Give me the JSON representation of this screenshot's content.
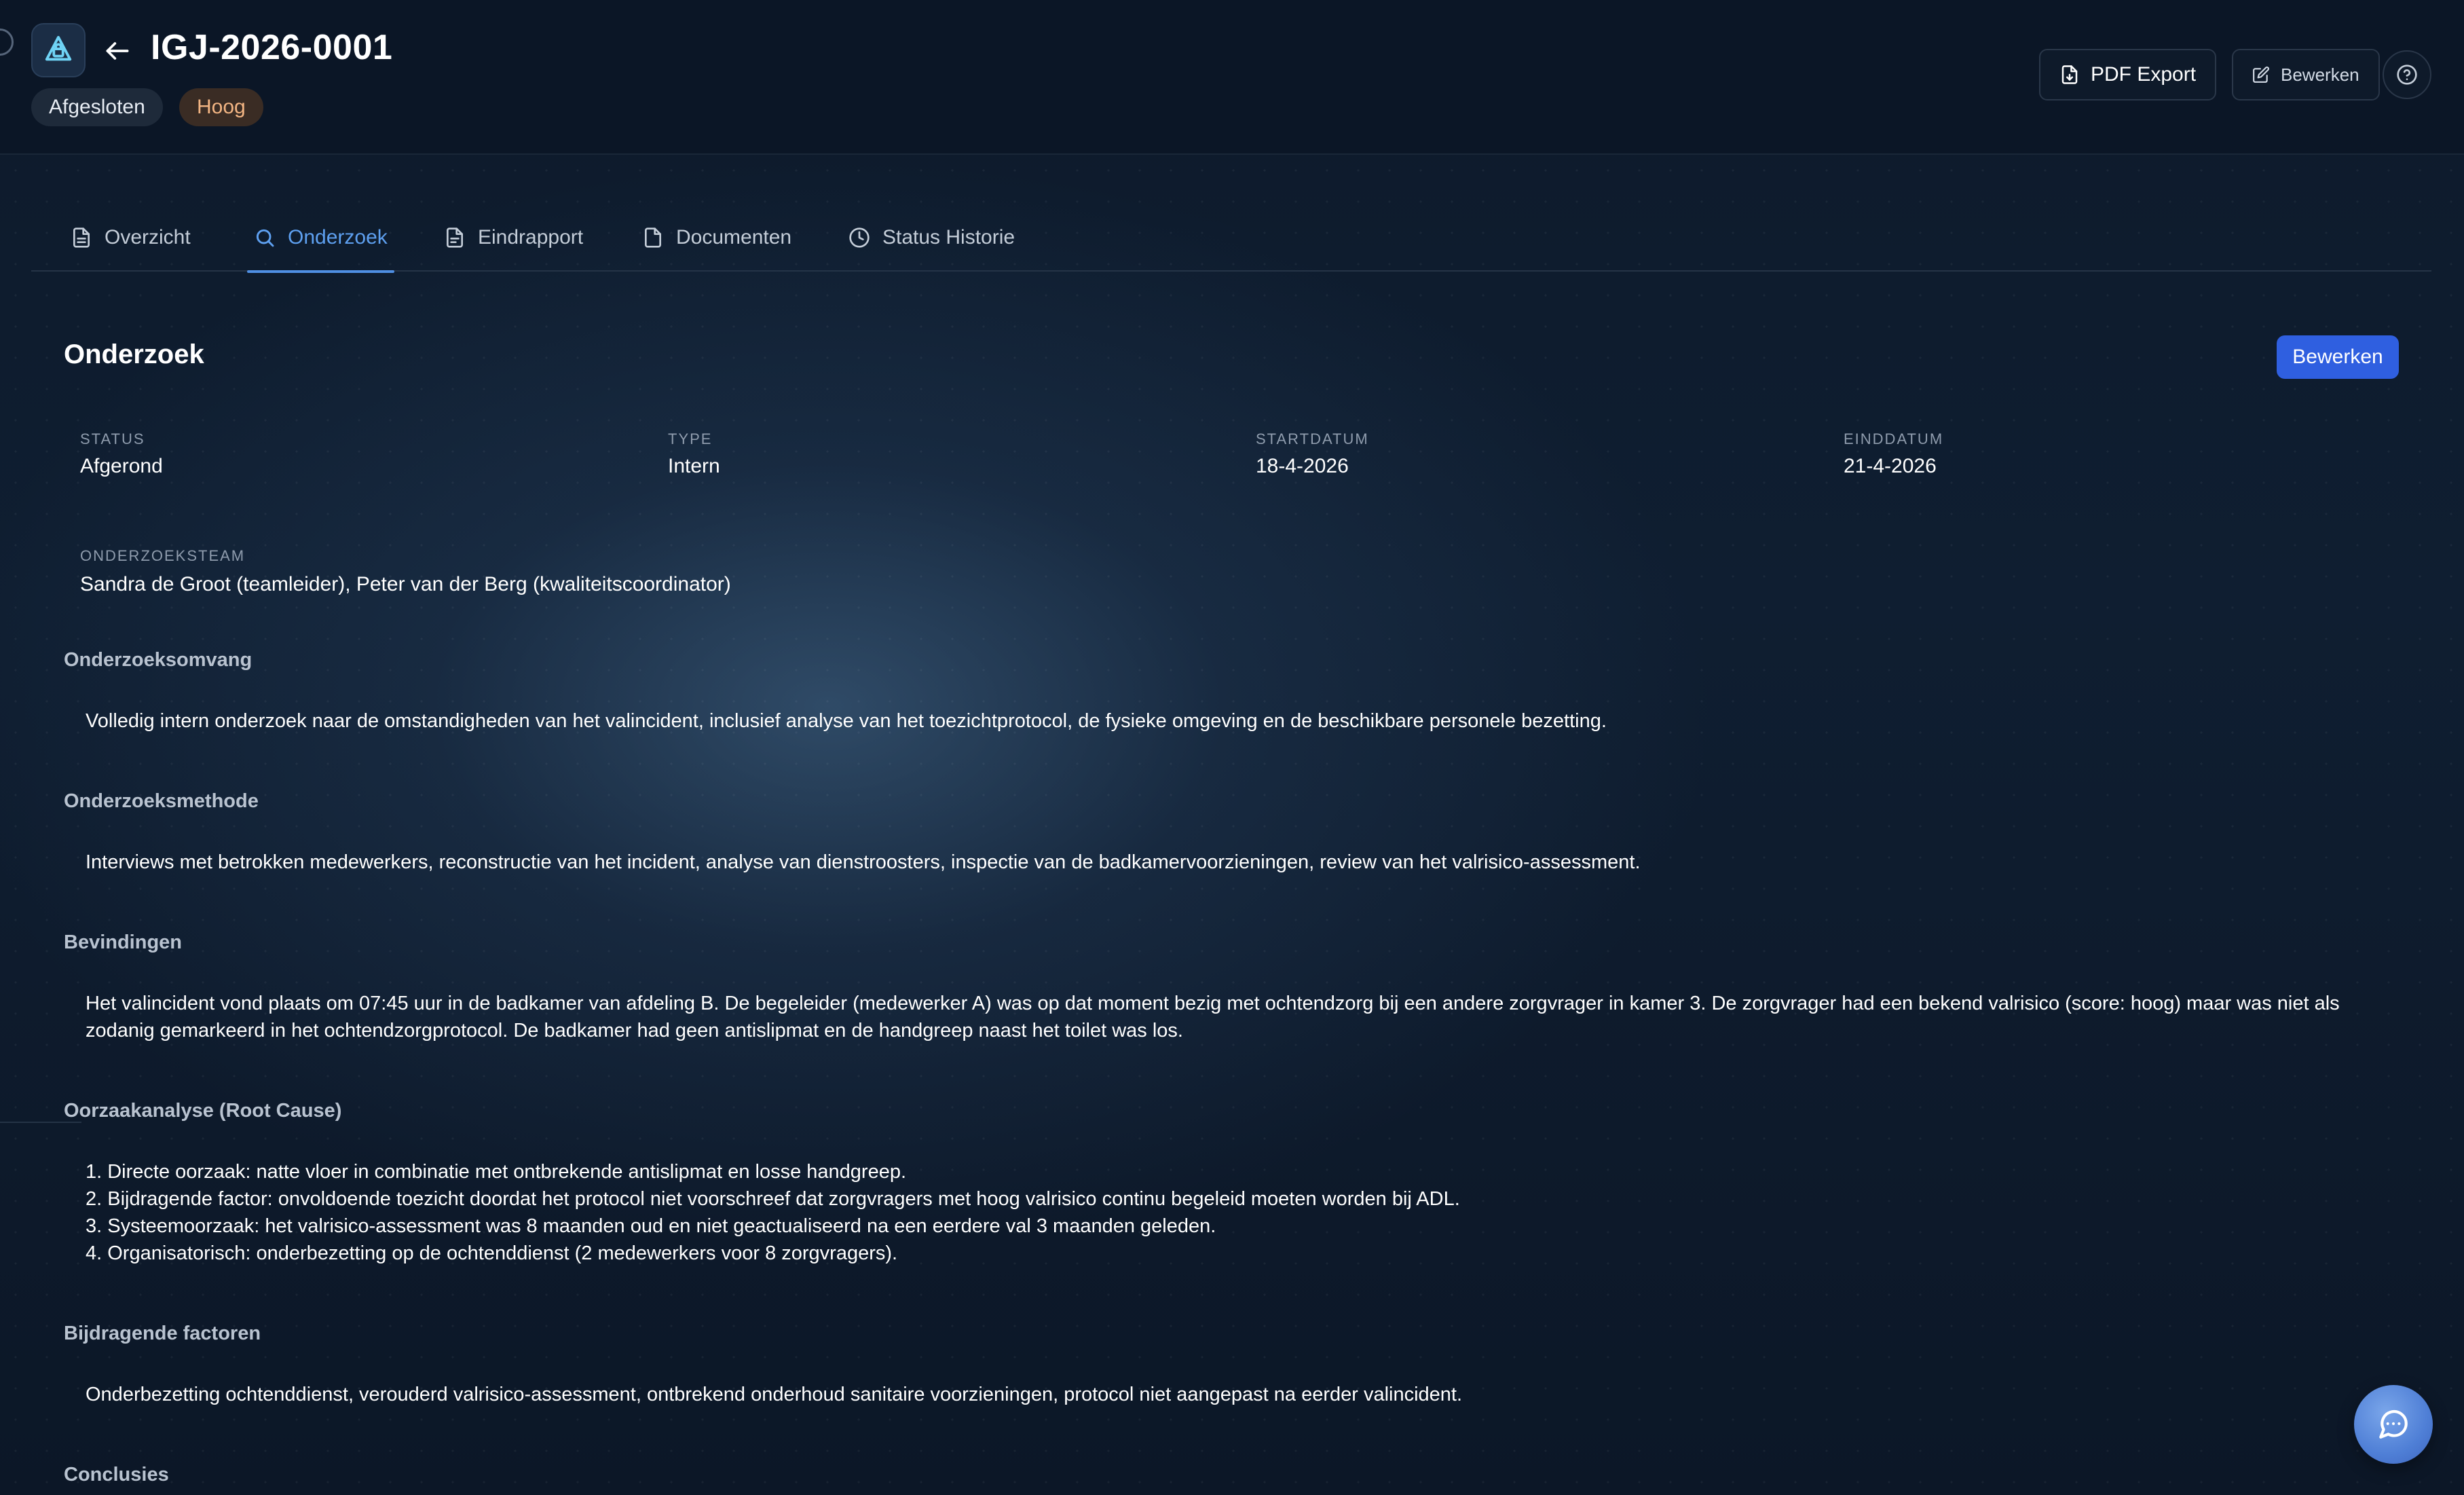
{
  "header": {
    "case_id": "IGJ-2026-0001",
    "status_badge": "Afgesloten",
    "priority_badge": "Hoog",
    "pdf_export_label": "PDF Export",
    "edit_label": "Bewerken"
  },
  "tabs": [
    {
      "label": "Overzicht",
      "icon": "document-icon"
    },
    {
      "label": "Onderzoek",
      "icon": "search-icon",
      "active": true
    },
    {
      "label": "Eindrapport",
      "icon": "report-icon"
    },
    {
      "label": "Documenten",
      "icon": "file-icon"
    },
    {
      "label": "Status Historie",
      "icon": "clock-icon"
    }
  ],
  "investigation": {
    "title": "Onderzoek",
    "edit_button": "Bewerken",
    "fields": [
      {
        "label": "Status",
        "value": "Afgerond"
      },
      {
        "label": "Type",
        "value": "Intern"
      },
      {
        "label": "Startdatum",
        "value": "18-4-2026"
      },
      {
        "label": "Einddatum",
        "value": "21-4-2026"
      }
    ],
    "team_label": "Onderzoeksteam",
    "team_value": "Sandra de Groot (teamleider), Peter van der Berg (kwaliteitscoordinator)",
    "sections": [
      {
        "title": "Onderzoeksomvang",
        "text": "Volledig intern onderzoek naar de omstandigheden van het valincident, inclusief analyse van het toezichtprotocol, de fysieke omgeving en de beschikbare personele bezetting."
      },
      {
        "title": "Onderzoeksmethode",
        "text": "Interviews met betrokken medewerkers, reconstructie van het incident, analyse van dienstroosters, inspectie van de badkamervoorzieningen, review van het valrisico-assessment."
      },
      {
        "title": "Bevindingen",
        "text": "Het valincident vond plaats om 07:45 uur in de badkamer van afdeling B. De begeleider (medewerker A) was op dat moment bezig met ochtendzorg bij een andere zorgvrager in kamer 3. De zorgvrager had een bekend valrisico (score: hoog) maar was niet als zodanig gemarkeerd in het ochtendzorgprotocol. De badkamer had geen antislipmat en de handgreep naast het toilet was los."
      },
      {
        "title": "Oorzaakanalyse (Root Cause)",
        "items": [
          "1. Directe oorzaak: natte vloer in combinatie met ontbrekende antislipmat en losse handgreep.",
          "2. Bijdragende factor: onvoldoende toezicht doordat het protocol niet voorschreef dat zorgvragers met hoog valrisico continu begeleid moeten worden bij ADL.",
          "3. Systeemoorzaak: het valrisico-assessment was 8 maanden oud en niet geactualiseerd na een eerdere val 3 maanden geleden.",
          "4. Organisatorisch: onderbezetting op de ochtenddienst (2 medewerkers voor 8 zorgvragers)."
        ]
      },
      {
        "title": "Bijdragende factoren",
        "text": "Onderbezetting ochtenddienst, verouderd valrisico-assessment, ontbrekend onderhoud sanitaire voorzieningen, protocol niet aangepast na eerder valincident."
      },
      {
        "title": "Conclusies"
      }
    ]
  },
  "colors": {
    "accent": "#2f5fe0",
    "active_tab": "#5ea0f0",
    "priority_text": "#f3b583",
    "background": "#0d1a2b"
  }
}
